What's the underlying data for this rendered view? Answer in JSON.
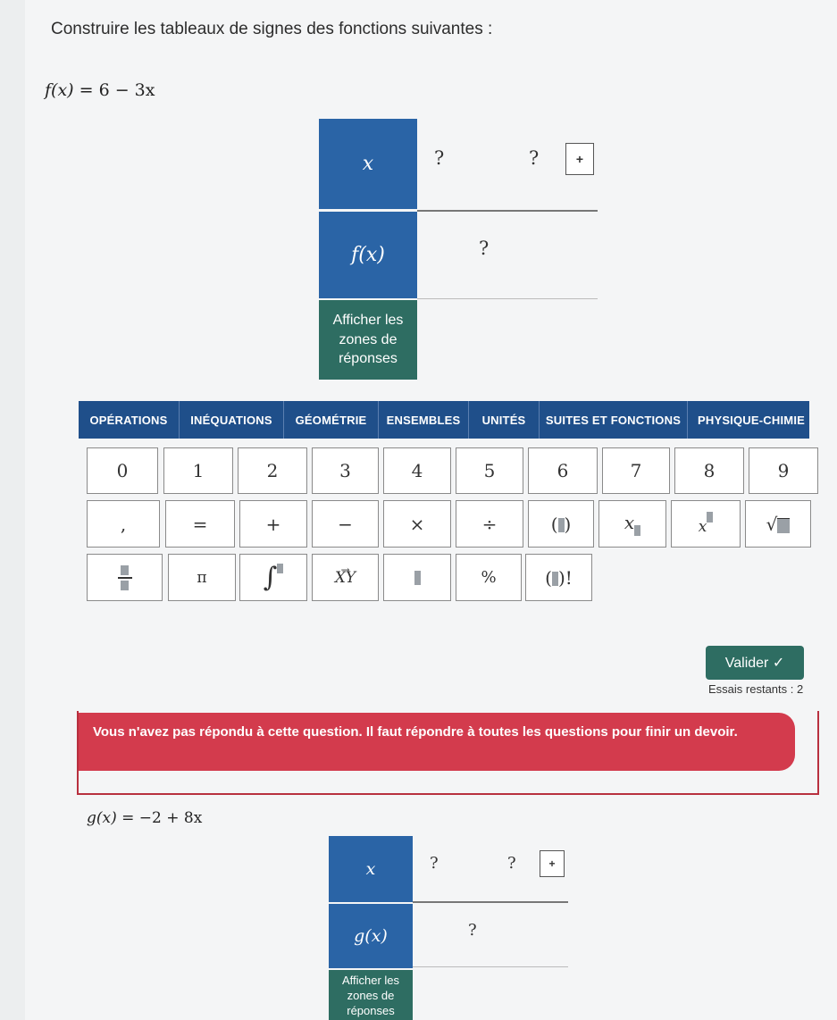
{
  "instruction": "Construire les tableaux de signes des fonctions suivantes :",
  "q1": {
    "function_lhs": "f(x)",
    "function_rhs": "= 6 − 3x",
    "table": {
      "x_label": "x",
      "row_label": "f(x)",
      "value1": "?",
      "value2": "?",
      "sign": "?",
      "add_button": "+",
      "show_zones": "Afficher les zones de réponses"
    }
  },
  "tabs": [
    "OPÉRATIONS",
    "INÉQUATIONS",
    "GÉOMÉTRIE",
    "ENSEMBLES",
    "UNITÉS",
    "SUITES ET FONCTIONS",
    "PHYSIQUE-CHIMIE"
  ],
  "keypad": {
    "digits": [
      "0",
      "1",
      "2",
      "3",
      "4",
      "5",
      "6",
      "7",
      "8",
      "9"
    ],
    "ops": [
      ",",
      "=",
      "+",
      "−",
      "×",
      "÷"
    ],
    "pi": "π",
    "percent": "%"
  },
  "valider_label": "Valider ✓",
  "essais": "Essais restants : 2",
  "alert": "Vous n'avez pas répondu à cette question. Il faut répondre à toutes les questions pour finir un devoir.",
  "q2": {
    "function_lhs": "g(x)",
    "function_rhs": "= −2 + 8x",
    "table": {
      "x_label": "x",
      "row_label": "g(x)",
      "value1": "?",
      "value2": "?",
      "sign": "?",
      "add_button": "+",
      "show_zones": "Afficher les zones de réponses"
    }
  }
}
